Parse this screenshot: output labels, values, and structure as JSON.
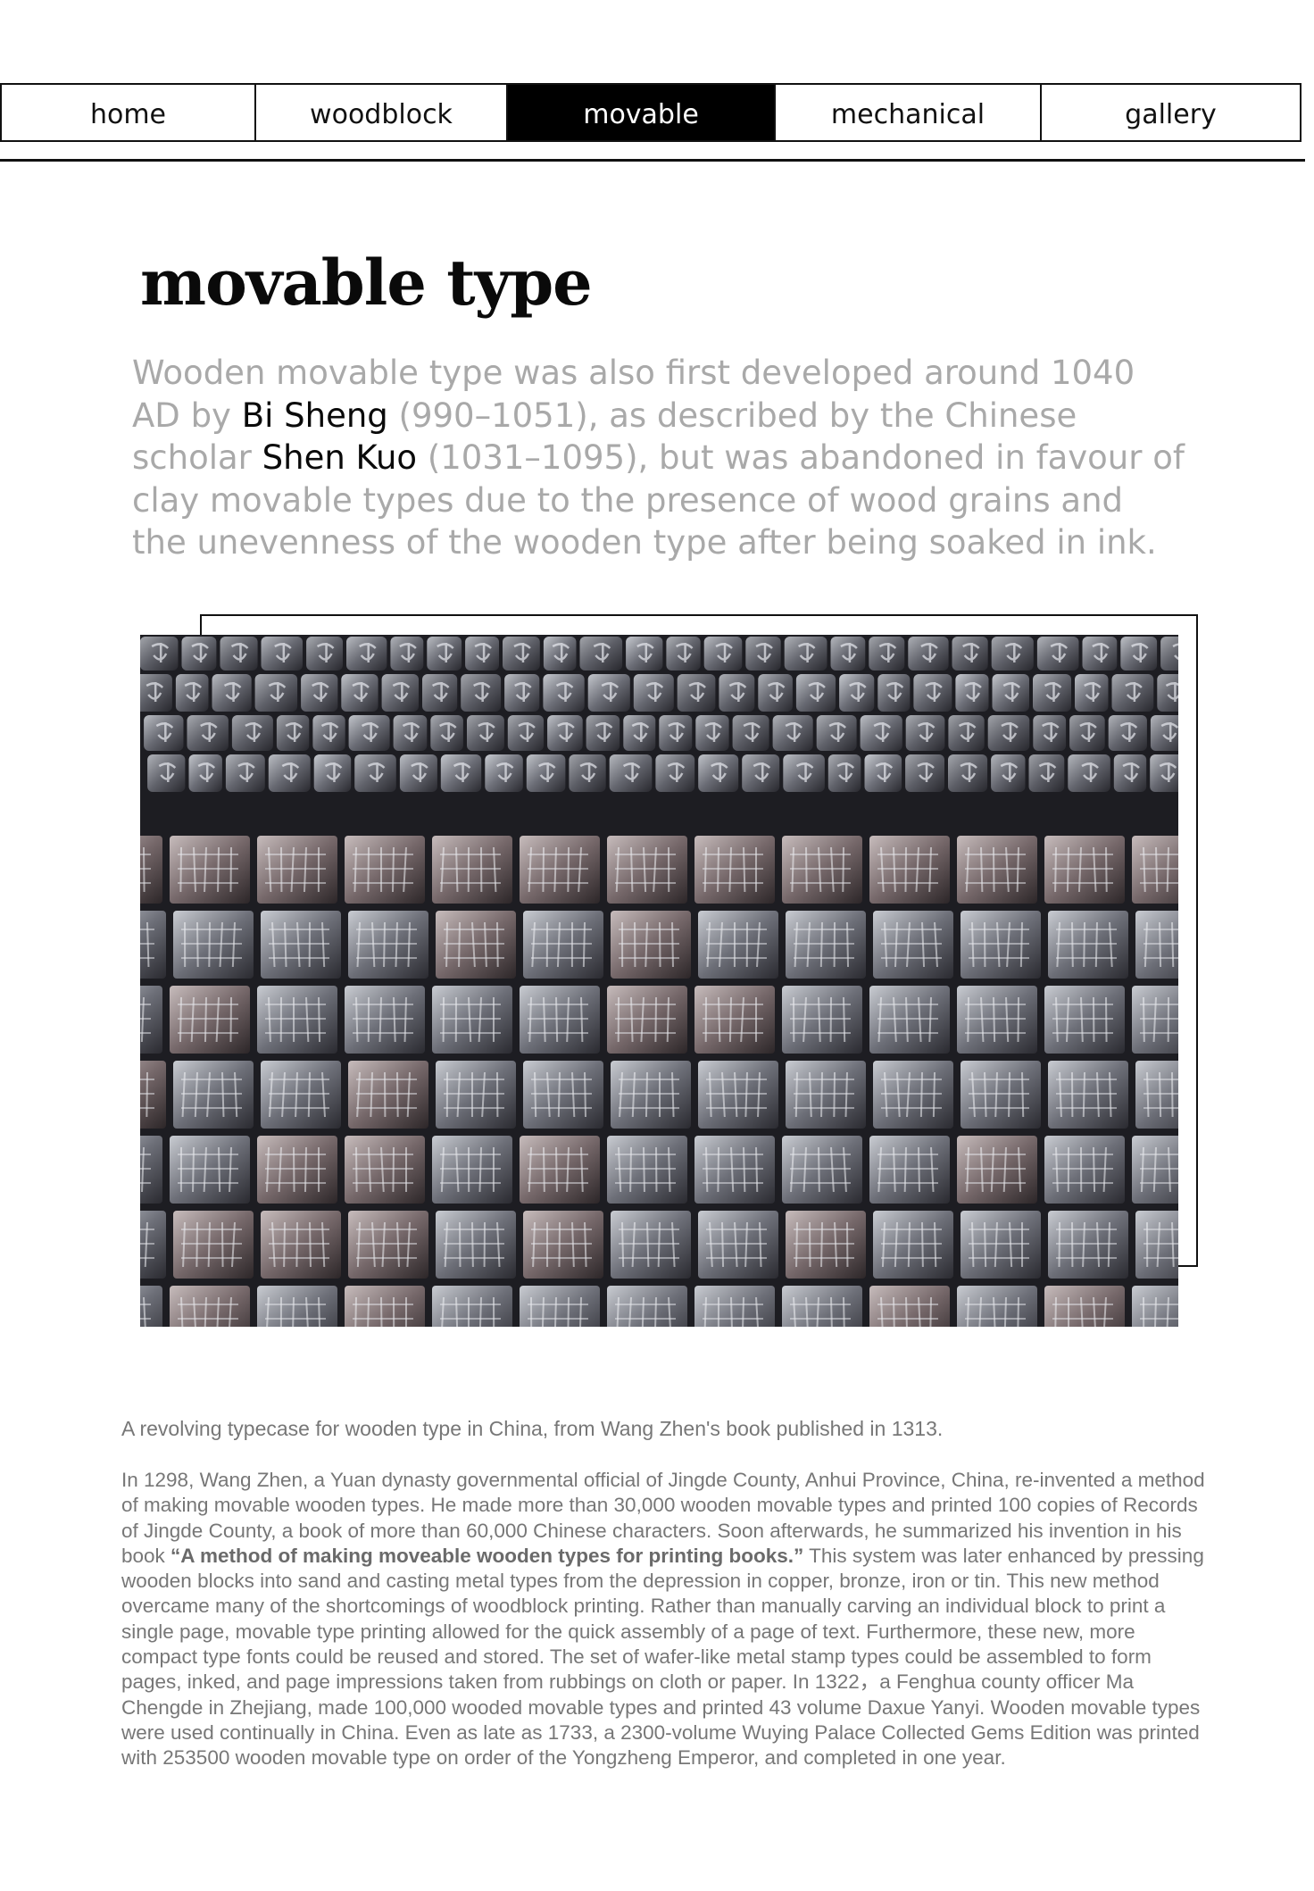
{
  "nav": {
    "items": [
      {
        "label": "home"
      },
      {
        "label": "woodblock"
      },
      {
        "label": "movable"
      },
      {
        "label": "mechanical"
      },
      {
        "label": "gallery"
      }
    ],
    "active": "movable"
  },
  "page": {
    "title": "movable type",
    "lead": {
      "part1": "Wooden movable type was also first developed around 1040 AD by ",
      "name1": "Bi Sheng",
      "part2": " (990–1051), as described by the Chinese scholar ",
      "name2": "Shen Kuo",
      "part3": " (1031–1095), but was abandoned in favour of clay movable types due to the presence of wood grains and the unevenness of the wooden type after being soaked in ink."
    },
    "caption": "A revolving typecase for wooden type in China, from Wang Zhen's book published in 1313.",
    "body": {
      "part1": "In 1298, Wang Zhen, a Yuan dynasty governmental official of Jingde County, Anhui Province, China, re-invented a method of making movable wooden types. He made more than 30,000 wooden movable types and printed 100 copies of Records of Jingde County, a book of more than 60,000 Chinese characters. Soon afterwards, he summarized his invention in his book ",
      "book_title": "“A method of making moveable wooden types for printing books.”",
      "part2": " This system was later enhanced by pressing wooden blocks into sand and casting metal types from the depression in copper, bronze, iron or tin. This new method overcame many of the shortcomings of woodblock printing. Rather than manually carving an individual block to print a single page, movable type printing allowed for the quick assembly of a page of text. Furthermore, these new, more compact type fonts could be reused and stored. The set of wafer-like metal stamp types could be assembled to form pages, inked, and page impressions taken from rubbings on cloth or paper. In 1322，a Fenghua county officer Ma Chengde in Zhejiang, made 100,000 wooded movable types and printed 43 volume Daxue Yanyi. Wooden movable types were used continually in China. Even as late as 1733, a 2300-volume Wuying Palace Collected Gems Edition was printed with 253500 wooden movable type on order of the Yongzheng Emperor, and completed in one year."
    }
  },
  "colors": {
    "accent": "#000000",
    "lead_text": "#a9a9a9",
    "body_text": "#777777"
  }
}
